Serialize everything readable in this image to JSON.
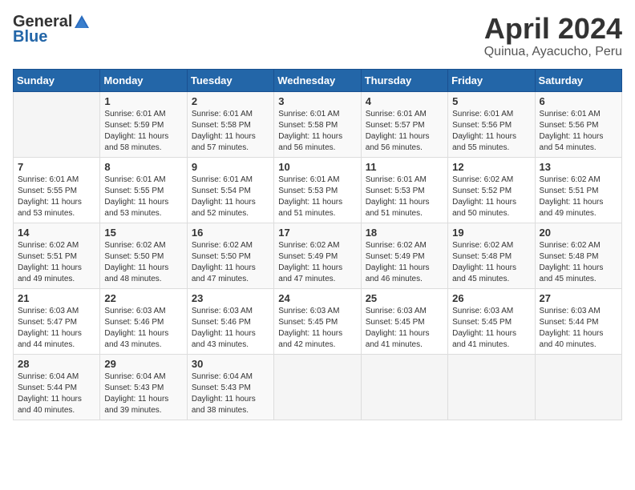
{
  "header": {
    "logo_general": "General",
    "logo_blue": "Blue",
    "month": "April 2024",
    "location": "Quinua, Ayacucho, Peru"
  },
  "weekdays": [
    "Sunday",
    "Monday",
    "Tuesday",
    "Wednesday",
    "Thursday",
    "Friday",
    "Saturday"
  ],
  "weeks": [
    [
      {
        "day": null
      },
      {
        "day": 1,
        "sunrise": "6:01 AM",
        "sunset": "5:59 PM",
        "daylight": "11 hours and 58 minutes."
      },
      {
        "day": 2,
        "sunrise": "6:01 AM",
        "sunset": "5:58 PM",
        "daylight": "11 hours and 57 minutes."
      },
      {
        "day": 3,
        "sunrise": "6:01 AM",
        "sunset": "5:58 PM",
        "daylight": "11 hours and 56 minutes."
      },
      {
        "day": 4,
        "sunrise": "6:01 AM",
        "sunset": "5:57 PM",
        "daylight": "11 hours and 56 minutes."
      },
      {
        "day": 5,
        "sunrise": "6:01 AM",
        "sunset": "5:56 PM",
        "daylight": "11 hours and 55 minutes."
      },
      {
        "day": 6,
        "sunrise": "6:01 AM",
        "sunset": "5:56 PM",
        "daylight": "11 hours and 54 minutes."
      }
    ],
    [
      {
        "day": 7,
        "sunrise": "6:01 AM",
        "sunset": "5:55 PM",
        "daylight": "11 hours and 53 minutes."
      },
      {
        "day": 8,
        "sunrise": "6:01 AM",
        "sunset": "5:55 PM",
        "daylight": "11 hours and 53 minutes."
      },
      {
        "day": 9,
        "sunrise": "6:01 AM",
        "sunset": "5:54 PM",
        "daylight": "11 hours and 52 minutes."
      },
      {
        "day": 10,
        "sunrise": "6:01 AM",
        "sunset": "5:53 PM",
        "daylight": "11 hours and 51 minutes."
      },
      {
        "day": 11,
        "sunrise": "6:01 AM",
        "sunset": "5:53 PM",
        "daylight": "11 hours and 51 minutes."
      },
      {
        "day": 12,
        "sunrise": "6:02 AM",
        "sunset": "5:52 PM",
        "daylight": "11 hours and 50 minutes."
      },
      {
        "day": 13,
        "sunrise": "6:02 AM",
        "sunset": "5:51 PM",
        "daylight": "11 hours and 49 minutes."
      }
    ],
    [
      {
        "day": 14,
        "sunrise": "6:02 AM",
        "sunset": "5:51 PM",
        "daylight": "11 hours and 49 minutes."
      },
      {
        "day": 15,
        "sunrise": "6:02 AM",
        "sunset": "5:50 PM",
        "daylight": "11 hours and 48 minutes."
      },
      {
        "day": 16,
        "sunrise": "6:02 AM",
        "sunset": "5:50 PM",
        "daylight": "11 hours and 47 minutes."
      },
      {
        "day": 17,
        "sunrise": "6:02 AM",
        "sunset": "5:49 PM",
        "daylight": "11 hours and 47 minutes."
      },
      {
        "day": 18,
        "sunrise": "6:02 AM",
        "sunset": "5:49 PM",
        "daylight": "11 hours and 46 minutes."
      },
      {
        "day": 19,
        "sunrise": "6:02 AM",
        "sunset": "5:48 PM",
        "daylight": "11 hours and 45 minutes."
      },
      {
        "day": 20,
        "sunrise": "6:02 AM",
        "sunset": "5:48 PM",
        "daylight": "11 hours and 45 minutes."
      }
    ],
    [
      {
        "day": 21,
        "sunrise": "6:03 AM",
        "sunset": "5:47 PM",
        "daylight": "11 hours and 44 minutes."
      },
      {
        "day": 22,
        "sunrise": "6:03 AM",
        "sunset": "5:46 PM",
        "daylight": "11 hours and 43 minutes."
      },
      {
        "day": 23,
        "sunrise": "6:03 AM",
        "sunset": "5:46 PM",
        "daylight": "11 hours and 43 minutes."
      },
      {
        "day": 24,
        "sunrise": "6:03 AM",
        "sunset": "5:45 PM",
        "daylight": "11 hours and 42 minutes."
      },
      {
        "day": 25,
        "sunrise": "6:03 AM",
        "sunset": "5:45 PM",
        "daylight": "11 hours and 41 minutes."
      },
      {
        "day": 26,
        "sunrise": "6:03 AM",
        "sunset": "5:45 PM",
        "daylight": "11 hours and 41 minutes."
      },
      {
        "day": 27,
        "sunrise": "6:03 AM",
        "sunset": "5:44 PM",
        "daylight": "11 hours and 40 minutes."
      }
    ],
    [
      {
        "day": 28,
        "sunrise": "6:04 AM",
        "sunset": "5:44 PM",
        "daylight": "11 hours and 40 minutes."
      },
      {
        "day": 29,
        "sunrise": "6:04 AM",
        "sunset": "5:43 PM",
        "daylight": "11 hours and 39 minutes."
      },
      {
        "day": 30,
        "sunrise": "6:04 AM",
        "sunset": "5:43 PM",
        "daylight": "11 hours and 38 minutes."
      },
      {
        "day": null
      },
      {
        "day": null
      },
      {
        "day": null
      },
      {
        "day": null
      }
    ]
  ],
  "labels": {
    "sunrise": "Sunrise:",
    "sunset": "Sunset:",
    "daylight": "Daylight:"
  }
}
